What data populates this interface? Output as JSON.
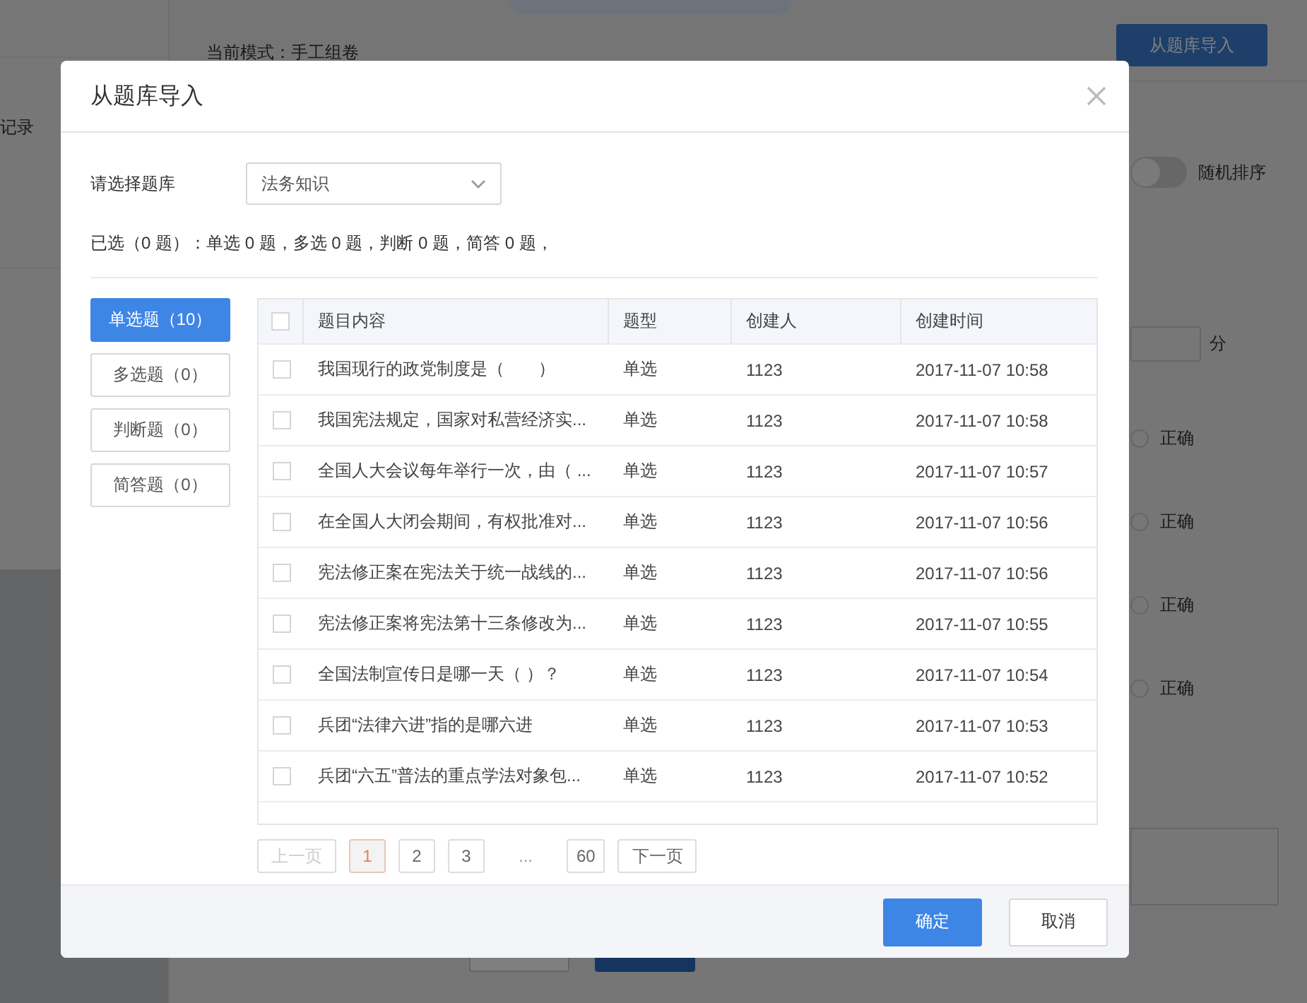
{
  "background": {
    "sidebar_item": "记录",
    "mode": "当前模式：手工组卷",
    "import_button": "从题库导入",
    "random_sort": {
      "label": "随机排序",
      "on": false
    },
    "score_unit": "分",
    "options": [
      {
        "label": "正确",
        "selected": false
      },
      {
        "label": "正确",
        "selected": false
      },
      {
        "label": "正确",
        "selected": false
      },
      {
        "label": "正确",
        "selected": false
      }
    ]
  },
  "dialog": {
    "title": "从题库导入",
    "bank_label": "请选择题库",
    "bank_value": "法务知识",
    "summary": "已选（0 题）：单选 0 题，多选 0 题，判断 0 题，简答 0 题，",
    "categories": [
      {
        "label": "单选题（10）",
        "selected": true
      },
      {
        "label": "多选题（0）",
        "selected": false
      },
      {
        "label": "判断题（0）",
        "selected": false
      },
      {
        "label": "简答题（0）",
        "selected": false
      }
    ],
    "table": {
      "all_checked": false,
      "columns": [
        "题目内容",
        "题型",
        "创建人",
        "创建时间"
      ],
      "rows": [
        {
          "checked": false,
          "content": "我国现行的政党制度是（　　）",
          "type": "单选",
          "creator": "1123",
          "time": "2017-11-07 10:58"
        },
        {
          "checked": false,
          "content": "我国宪法规定，国家对私营经济实...",
          "type": "单选",
          "creator": "1123",
          "time": "2017-11-07 10:58"
        },
        {
          "checked": false,
          "content": "全国人大会议每年举行一次，由（ ...",
          "type": "单选",
          "creator": "1123",
          "time": "2017-11-07 10:57"
        },
        {
          "checked": false,
          "content": "在全国人大闭会期间，有权批准对...",
          "type": "单选",
          "creator": "1123",
          "time": "2017-11-07 10:56"
        },
        {
          "checked": false,
          "content": "宪法修正案在宪法关于统一战线的...",
          "type": "单选",
          "creator": "1123",
          "time": "2017-11-07 10:56"
        },
        {
          "checked": false,
          "content": "宪法修正案将宪法第十三条修改为...",
          "type": "单选",
          "creator": "1123",
          "time": "2017-11-07 10:55"
        },
        {
          "checked": false,
          "content": "全国法制宣传日是哪一天（ ）？",
          "type": "单选",
          "creator": "1123",
          "time": "2017-11-07 10:54"
        },
        {
          "checked": false,
          "content": "兵团“法律六进”指的是哪六进",
          "type": "单选",
          "creator": "1123",
          "time": "2017-11-07 10:53"
        },
        {
          "checked": false,
          "content": "兵团“六五”普法的重点学法对象包...",
          "type": "单选",
          "creator": "1123",
          "time": "2017-11-07 10:52"
        }
      ]
    },
    "pagination": {
      "prev": {
        "label": "上一页",
        "disabled": true
      },
      "pages": [
        {
          "label": "1",
          "selected": true
        },
        {
          "label": "2",
          "selected": false
        },
        {
          "label": "3",
          "selected": false
        },
        {
          "label": "...",
          "kind": "ellipsis"
        },
        {
          "label": "60",
          "selected": false
        }
      ],
      "next": {
        "label": "下一页",
        "disabled": false
      }
    },
    "buttons": [
      {
        "label": "确定",
        "kind": "primary"
      },
      {
        "label": "取消",
        "kind": "default"
      }
    ]
  }
}
